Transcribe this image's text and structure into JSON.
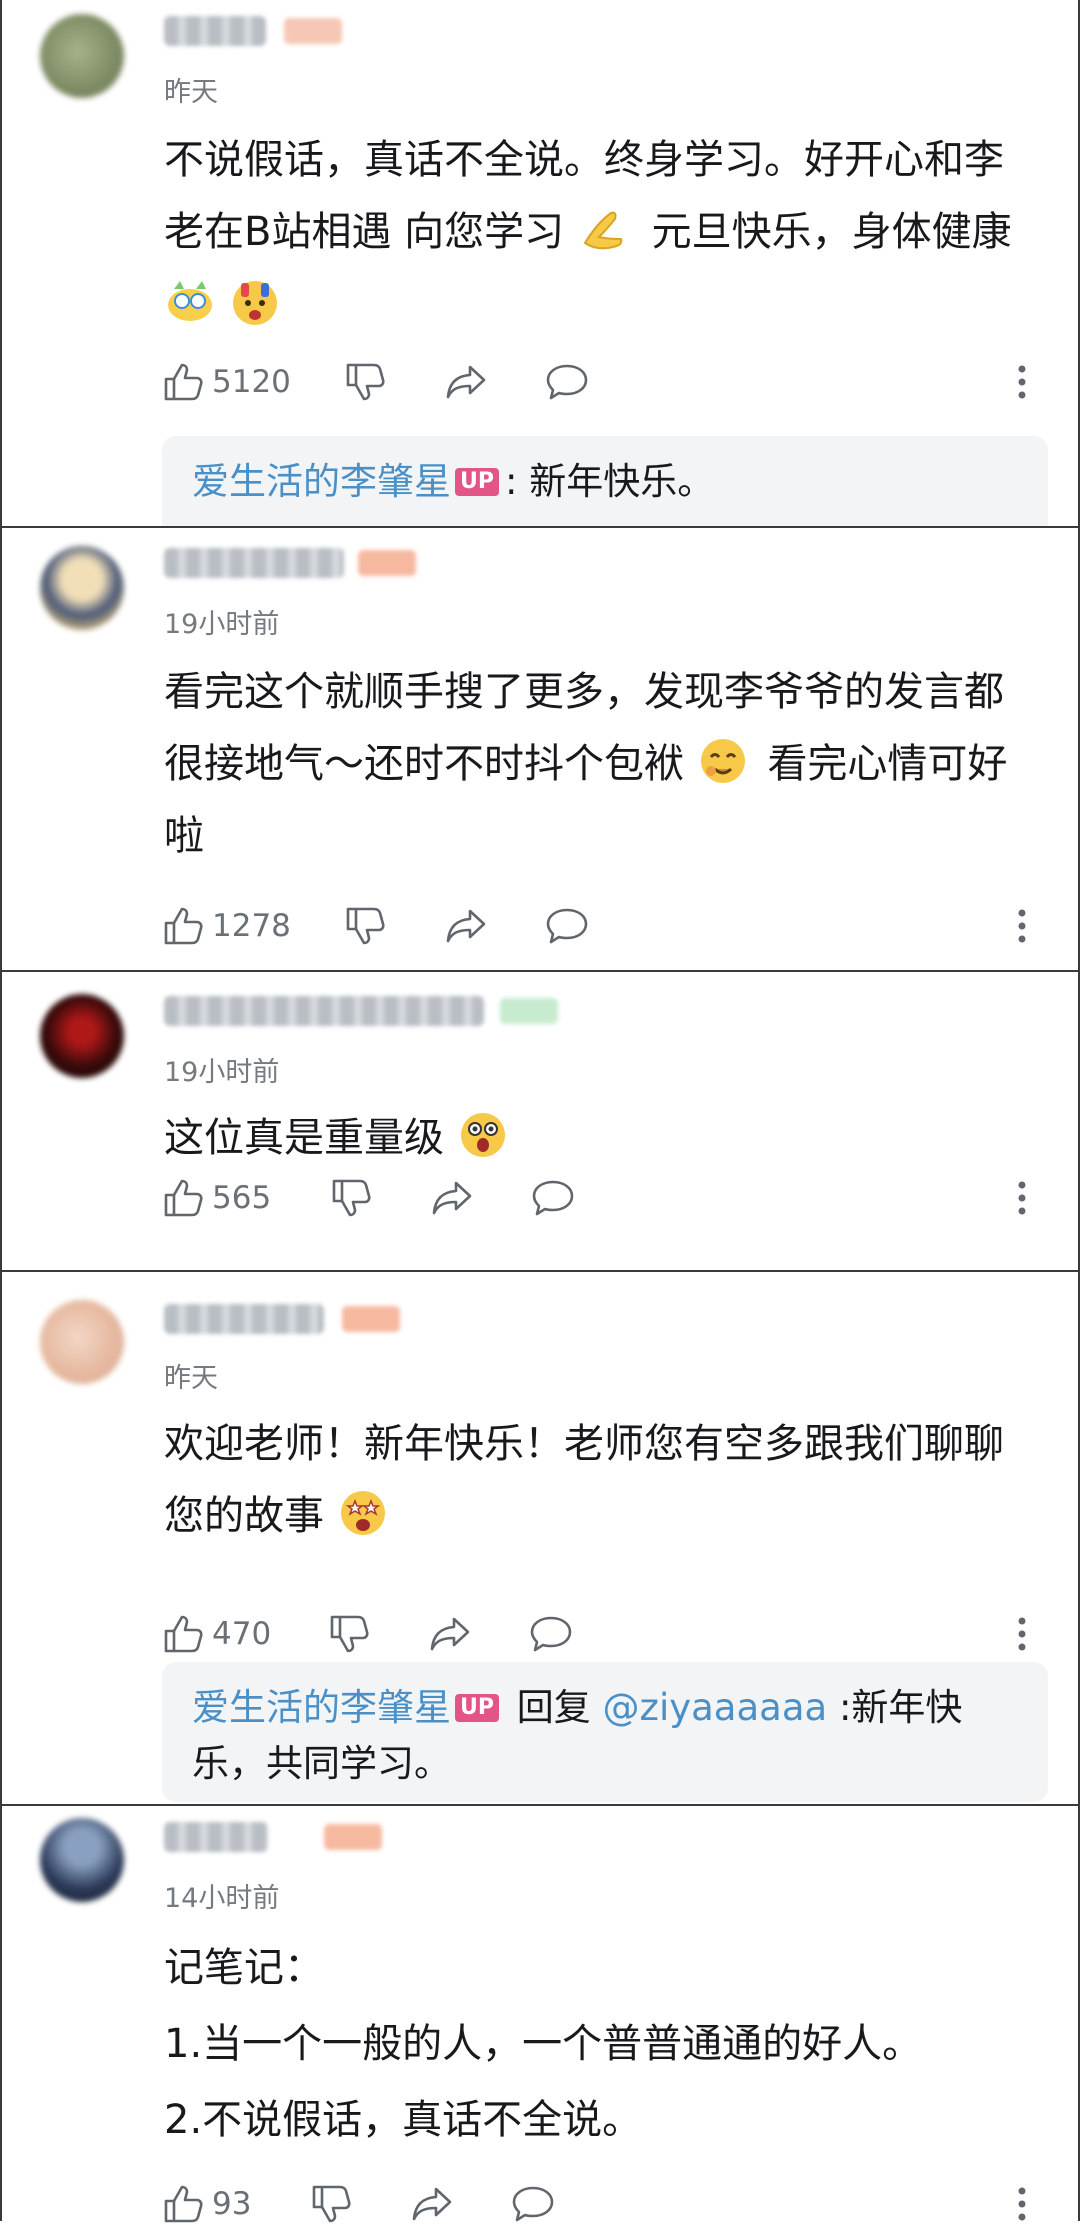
{
  "comments": [
    {
      "time": "昨天",
      "text_lines": [
        "不说假话，真话不全说。终身学习。好开心和李",
        "老在B站相遇 向您学习",
        "元旦快乐，身体健康"
      ],
      "likes": "5120",
      "reply": {
        "author": "爱生活的李肇星",
        "badge": "UP",
        "content": ": 新年快乐。"
      }
    },
    {
      "time": "19小时前",
      "text_lines": [
        "看完这个就顺手搜了更多，发现李爷爷的发言都",
        "很接地气～还时不时抖个包袱",
        "看完心情可好",
        "啦"
      ],
      "likes": "1278"
    },
    {
      "time": "19小时前",
      "text_lines": [
        "这位真是重量级"
      ],
      "likes": "565"
    },
    {
      "time": "昨天",
      "text_lines": [
        "欢迎老师！新年快乐！老师您有空多跟我们聊聊",
        "您的故事"
      ],
      "likes": "470",
      "reply": {
        "author": "爱生活的李肇星",
        "badge": "UP",
        "action": "回复",
        "mention": "@ziyaaaaaa",
        "content": ":新年快",
        "content2": "乐，共同学习。"
      }
    },
    {
      "time": "14小时前",
      "text_lines": [
        "记笔记：",
        "1.当一个一般的人，一个普普通通的好人。",
        "2.不说假话，真话不全说。"
      ],
      "likes": "93"
    }
  ],
  "icons": {
    "like": "thumbs-up-icon",
    "dislike": "thumbs-down-icon",
    "share": "share-icon",
    "comment": "comment-bubble-icon",
    "more": "more-vertical-icon"
  },
  "colors": {
    "name_link": "#4a90c6",
    "up_badge": "#e35587",
    "meta_text": "#757a80",
    "reply_bg": "#f3f4f6"
  }
}
